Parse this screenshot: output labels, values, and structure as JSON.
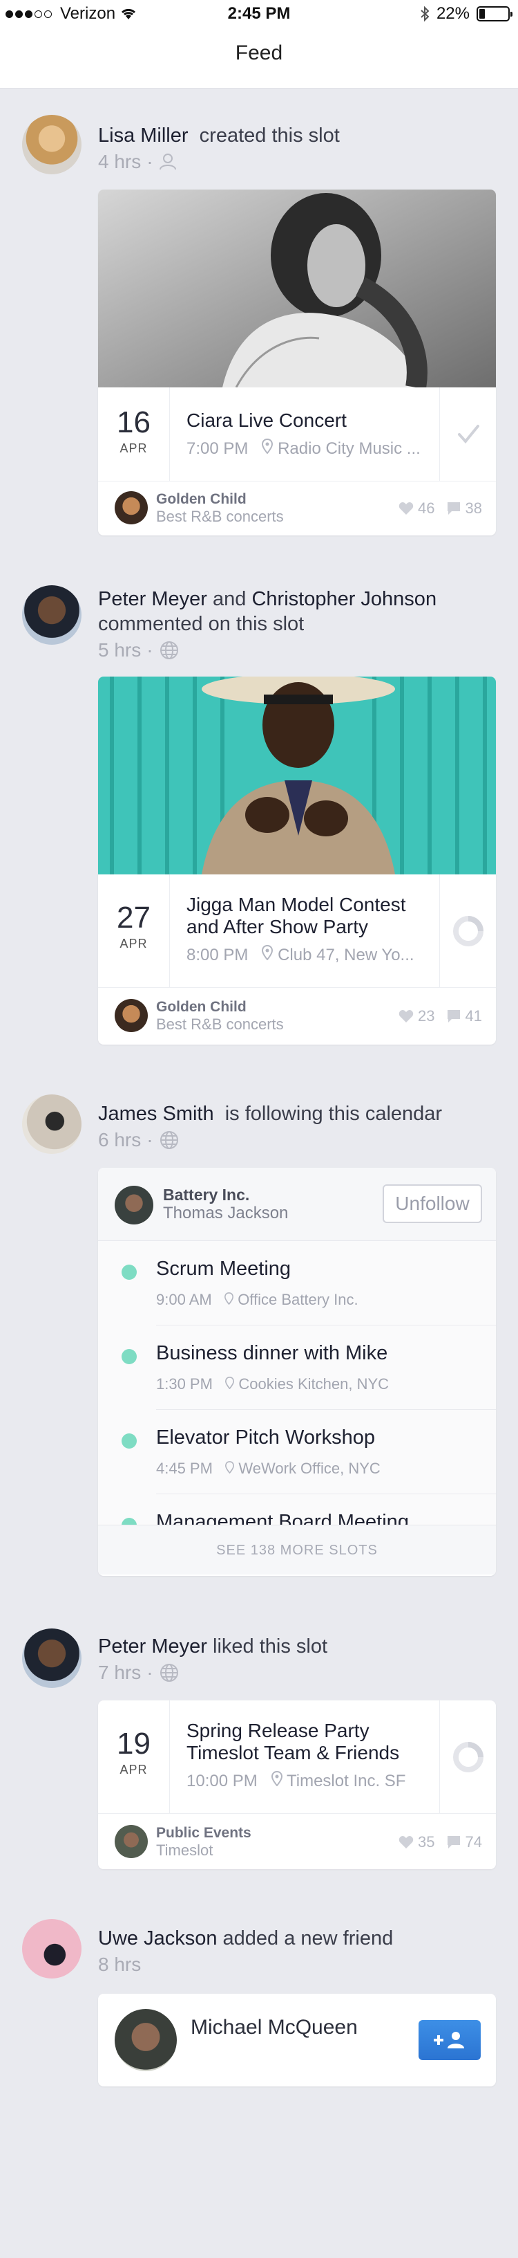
{
  "status_bar": {
    "carrier": "Verizon",
    "time": "2:45 PM",
    "battery": "22%"
  },
  "nav": {
    "title": "Feed"
  },
  "feed": [
    {
      "actor": "Lisa Miller",
      "action": "created this slot",
      "time": "4 hrs",
      "event": {
        "day": "16",
        "month": "APR",
        "title": "Ciara Live Concert",
        "time": "7:00 PM",
        "location": "Radio City Music ..."
      },
      "calendar": {
        "name": "Golden Child",
        "subtitle": "Best R&B concerts",
        "likes": "46",
        "comments": "38"
      }
    },
    {
      "actor": "Peter Meyer",
      "joiner": "and",
      "actor2": "Christopher Johnson",
      "action": "commented on this slot",
      "time": "5 hrs",
      "event": {
        "day": "27",
        "month": "APR",
        "title": "Jigga Man Model Contest and After Show Party",
        "time": "8:00 PM",
        "location": "Club 47, New Yo..."
      },
      "calendar": {
        "name": "Golden Child",
        "subtitle": "Best R&B concerts",
        "likes": "23",
        "comments": "41"
      }
    },
    {
      "actor": "James Smith",
      "action": "is following this calendar",
      "time": "6 hrs",
      "following": {
        "calendar": "Battery Inc.",
        "owner": "Thomas Jackson",
        "button": "Unfollow",
        "slots": [
          {
            "title": "Scrum Meeting",
            "time": "9:00 AM",
            "location": "Office Battery Inc."
          },
          {
            "title": "Business dinner with Mike",
            "time": "1:30 PM",
            "location": "Cookies Kitchen, NYC"
          },
          {
            "title": "Elevator Pitch Workshop",
            "time": "4:45 PM",
            "location": "WeWork Office, NYC"
          },
          {
            "title": "Management Board Meeting"
          }
        ],
        "see_more": "SEE 138 MORE SLOTS"
      }
    },
    {
      "actor": "Peter Meyer",
      "action": "liked this slot",
      "time": "7 hrs",
      "event": {
        "day": "19",
        "month": "APR",
        "title": "Spring Release Party Timeslot Team & Friends",
        "time": "10:00 PM",
        "location": "Timeslot Inc. SF"
      },
      "calendar": {
        "name": "Public Events",
        "subtitle": "Timeslot",
        "likes": "35",
        "comments": "74"
      }
    },
    {
      "actor": "Uwe Jackson",
      "action": "added a new friend",
      "time": "8 hrs",
      "friend": {
        "name": "Michael McQueen"
      }
    }
  ],
  "colors": {
    "accent_blue": "#2b74d2",
    "mint_dot": "#7edcc3",
    "background": "#e9eaef"
  }
}
